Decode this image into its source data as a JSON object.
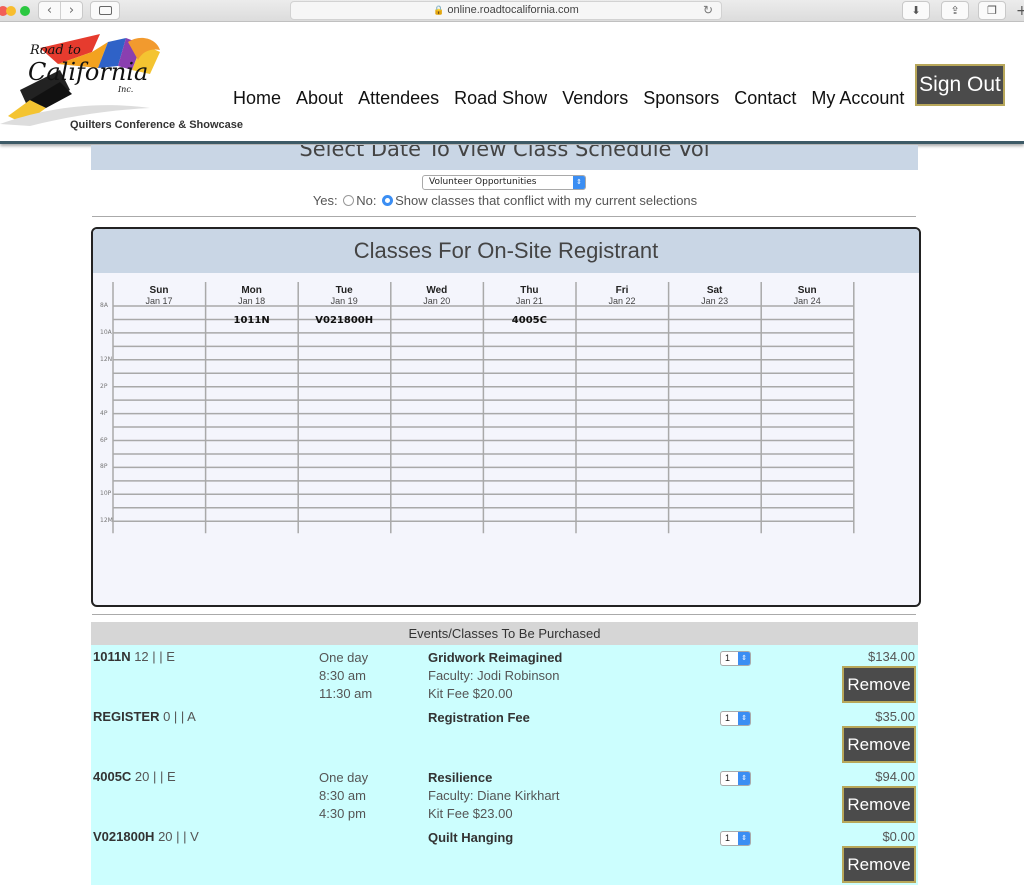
{
  "browser": {
    "url": "online.roadtocalifornia.com"
  },
  "header": {
    "logo_top": "Road to",
    "logo_main": "California",
    "logo_inc": "Inc.",
    "logo_caption": "Quilters Conference & Showcase",
    "nav": [
      "Home",
      "About",
      "Attendees",
      "Road Show",
      "Vendors",
      "Sponsors",
      "Contact",
      "My Account"
    ],
    "signout_label": "Sign Out"
  },
  "schedule": {
    "header": "Select Date To View Class Schedule Vol",
    "select_value": "Volunteer Opportunities",
    "yes_label": "Yes:",
    "no_label": "No:",
    "conflict_label": "Show classes that conflict with my current selections",
    "conflict_selected": "no"
  },
  "calendar": {
    "title": "Classes For On-Site Registrant",
    "days": [
      {
        "name": "Sun",
        "date": "Jan 17",
        "event": ""
      },
      {
        "name": "Mon",
        "date": "Jan 18",
        "event": "1011N"
      },
      {
        "name": "Tue",
        "date": "Jan 19",
        "event": "V021800H"
      },
      {
        "name": "Wed",
        "date": "Jan 20",
        "event": ""
      },
      {
        "name": "Thu",
        "date": "Jan 21",
        "event": "4005C"
      },
      {
        "name": "Fri",
        "date": "Jan 22",
        "event": ""
      },
      {
        "name": "Sat",
        "date": "Jan 23",
        "event": ""
      },
      {
        "name": "Sun",
        "date": "Jan 24",
        "event": ""
      }
    ],
    "times": [
      "8A",
      "10A",
      "12N",
      "2P",
      "4P",
      "6P",
      "8P",
      "10P",
      "12M"
    ]
  },
  "events": {
    "header": "Events/Classes To Be Purchased",
    "remove_label": "Remove",
    "items": [
      {
        "code": "1011N",
        "meta": "12 | | E",
        "when": [
          "One day",
          "8:30 am",
          "11:30 am"
        ],
        "title": "Gridwork Reimagined",
        "details": [
          "Faculty: Jodi Robinson",
          "Kit Fee $20.00"
        ],
        "qty": "1",
        "price": "$134.00"
      },
      {
        "code": "REGISTER",
        "meta": "0 | | A",
        "when": [],
        "title": "Registration Fee",
        "details": [],
        "qty": "1",
        "price": "$35.00"
      },
      {
        "code": "4005C",
        "meta": "20 | | E",
        "when": [
          "One day",
          "8:30 am",
          "4:30 pm"
        ],
        "title": "Resilience",
        "details": [
          "Faculty: Diane Kirkhart",
          "Kit Fee $23.00"
        ],
        "qty": "1",
        "price": "$94.00"
      },
      {
        "code": "V021800H",
        "meta": "20 | | V",
        "when": [],
        "title": "Quilt Hanging",
        "details": [],
        "qty": "1",
        "price": "$0.00"
      }
    ]
  }
}
